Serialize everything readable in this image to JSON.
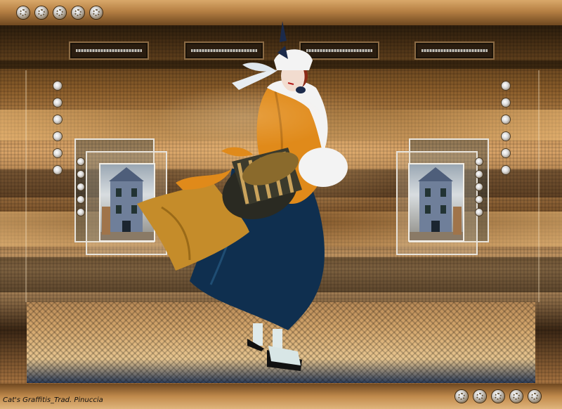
{
  "credit": {
    "text": "Cat's Graffitis_Trad. Pinuccia"
  },
  "palette": {
    "bronze_light": "#e0b27a",
    "bronze_dark": "#3a2614",
    "navy": "#0f2f4f",
    "gold": "#d08a18"
  },
  "icons": {
    "top_dots": [
      "knob-icon",
      "knob-icon",
      "knob-icon",
      "knob-icon",
      "knob-icon"
    ],
    "bottom_dots": [
      "knob-icon",
      "knob-icon",
      "knob-icon",
      "knob-icon",
      "knob-icon"
    ]
  }
}
